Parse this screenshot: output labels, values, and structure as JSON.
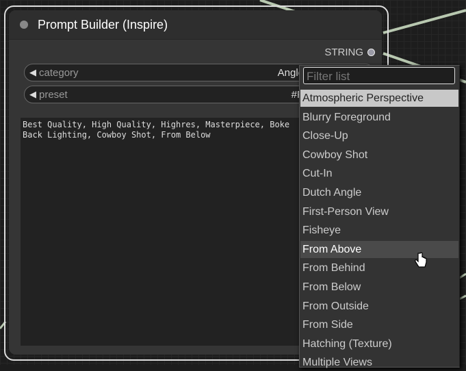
{
  "node": {
    "title": "Prompt Builder (Inspire)",
    "output_label": "STRING",
    "widgets": [
      {
        "label": "category",
        "value": "Angle"
      },
      {
        "label": "preset",
        "value": "#P"
      }
    ],
    "text": "Best Quality, High Quality, Highres, Masterpiece, Boke\nBack Lighting, Cowboy Shot, From Below"
  },
  "dropdown": {
    "filter_placeholder": "Filter list",
    "items": [
      "Atmospheric Perspective",
      "Blurry Foreground",
      "Close-Up",
      "Cowboy Shot",
      "Cut-In",
      "Dutch Angle",
      "First-Person View",
      "Fisheye",
      "From Above",
      "From Behind",
      "From Below",
      "From Outside",
      "From Side",
      "Hatching (Texture)",
      "Multiple Views"
    ],
    "selected": "Atmospheric Perspective",
    "hovered": "From Above"
  },
  "colors": {
    "wire": "#b8c8b0",
    "node_bg": "#353535",
    "outline": "#dddddd"
  }
}
